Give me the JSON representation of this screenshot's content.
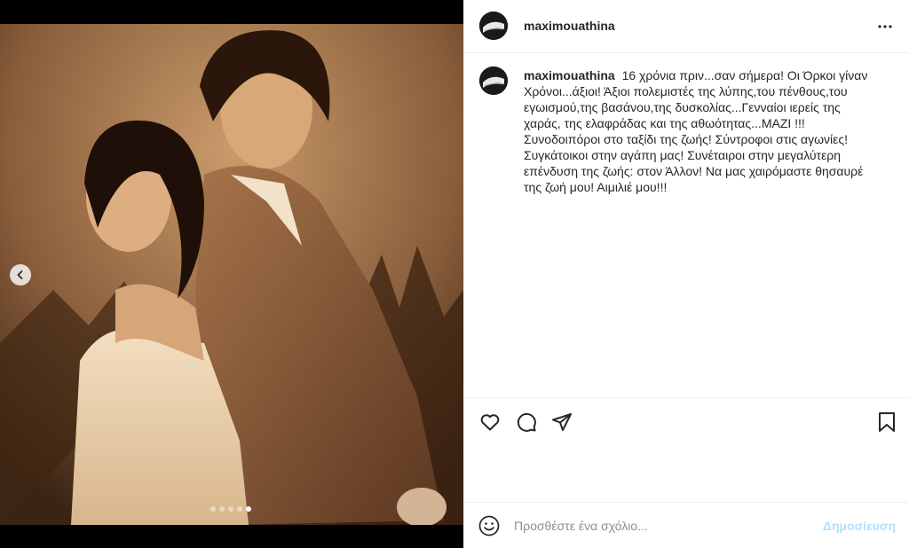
{
  "post": {
    "username": "maximouathina",
    "caption_username": "maximouathina",
    "caption": "16 χρόνια πριν...σαν σήμερα! Οι Όρκοι γίναν Χρόνοι...άξιοι! Άξιοι πολεμιστές της λύπης,του πένθους,του εγωισμού,της βασάνου,της δυσκολίας...Γενναίοι ιερείς της χαράς, της ελαφράδας και της αθωότητας...ΜΑΖΙ !!! Συνοδοιπόροι στο ταξίδι της ζωής! Σύντροφοι στις αγωνίες! Συγκάτοικοι στην αγάπη μας! Συνέταιροι στην μεγαλύτερη επένδυση της ζωής: στον Άλλον! Να μας χαιρόμαστε θησαυρέ της ζωή μου! Αιμιλιέ μου!!!"
  },
  "carousel": {
    "total": 5,
    "active_index": 4
  },
  "icons": {
    "more": "more-horizontal-icon",
    "prev": "chevron-left-icon",
    "like": "heart-icon",
    "comment": "comment-icon",
    "share": "send-icon",
    "save": "bookmark-icon",
    "emoji": "smiley-icon"
  },
  "comment_box": {
    "placeholder": "Προσθέστε ένα σχόλιο...",
    "post_label": "Δημοσίευση"
  },
  "colors": {
    "post_button_disabled": "#b2dffc",
    "text": "#262626",
    "placeholder": "#8e8e8e"
  }
}
